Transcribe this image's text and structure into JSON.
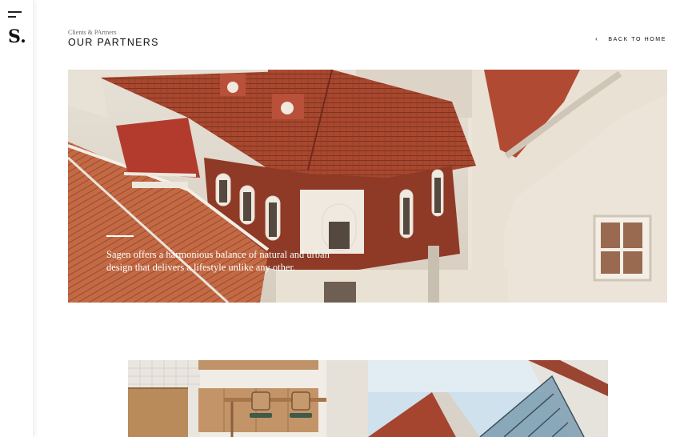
{
  "sidebar": {
    "logo": "S.",
    "menu_icon": "hamburger-menu-icon"
  },
  "header": {
    "breadcrumb": "Clients & PArtners",
    "title": "OUR PARTNERS",
    "back_label": "BACK TO HOME",
    "back_icon": "chevron-left-icon"
  },
  "hero": {
    "caption": "Sagen offers a harmonious balance of natural and urban design that delivers a lifestyle unlike any other."
  },
  "colors": {
    "roof": "#a4462f",
    "roof_dark": "#7a2f1f",
    "wall": "#ece4d8",
    "accent_red": "#b5473a"
  }
}
